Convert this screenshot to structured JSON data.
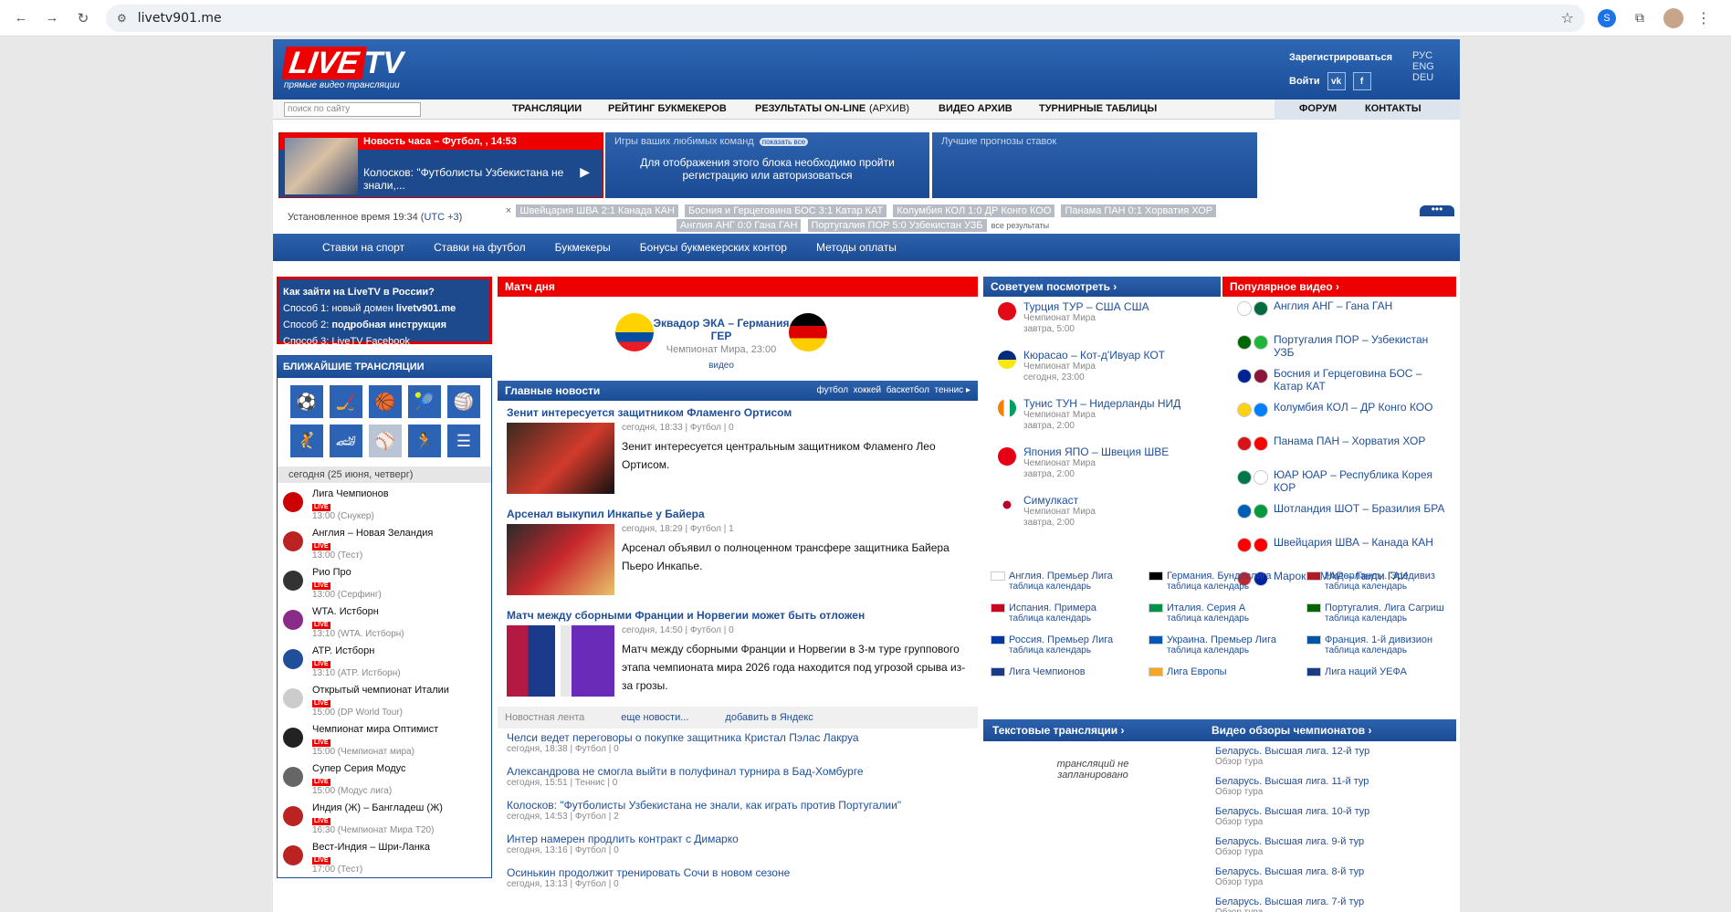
{
  "browser": {
    "url": "livetv901.me"
  },
  "header": {
    "logo_live": "LIVE",
    "logo_tv": "TV",
    "logo_sub": "прямые видео трансляции",
    "register": "Зарегистрироваться",
    "login": "Войти",
    "vk": "vk",
    "fb": "f",
    "langs": [
      "РУС",
      "ENG",
      "DEU"
    ]
  },
  "menu": {
    "search_placeholder": "поиск по сайту",
    "items": [
      "ТРАНСЛЯЦИИ",
      "РЕЙТИНГ БУКМЕКЕРОВ",
      "РЕЗУЛЬТАТЫ ON-LINE",
      "(АРХИВ)",
      "ВИДЕО АРХИВ",
      "ТУРНИРНЫЕ ТАБЛИЦЫ",
      "ФОРУМ",
      "КОНТАКТЫ"
    ]
  },
  "news_hour": {
    "title": "Новость часа – Футбол, , 14:53",
    "text": "Колосков: \"Футболисты Узбекистана не знали,..."
  },
  "fav": {
    "title": "Игры ваших любимых команд",
    "tag": "показать все",
    "body": "Для отображения этого блока необходимо пройти регистрацию или авторизоваться"
  },
  "forecast": {
    "title": "Лучшие прогнозы ставок"
  },
  "time": {
    "label": "Установленное время 19:34 (",
    "tz": "UTC +3",
    ")": ")"
  },
  "ticker": {
    "x": "×",
    "matches": [
      "Швейцария ШВА 2:1 Канада КАН",
      "Босния и Герцеговина БОС 3:1 Катар КАТ",
      "Колумбия КОЛ 1:0 ДР Конго КОО",
      "Панама ПАН 0:1 Хорватия ХОР",
      "Англия АНГ 0:0 Гана ГАН",
      "Португалия ПОР 5:0 Узбекистан УЗБ"
    ],
    "all": "все результаты",
    "more": "•••"
  },
  "bar": [
    "Ставки на спорт",
    "Ставки на футбол",
    "Букмекеры",
    "Бонусы букмекерских контор",
    "Методы оплаты"
  ],
  "howto": {
    "title": "Как зайти на LiveTV в России?",
    "l1": "Способ 1: новый домен ",
    "l1b": "livetv901.me",
    "l2": "Способ 2: ",
    "l2b": "подробная инструкция",
    "l3": "Способ 3: LiveTV Facebook"
  },
  "near": {
    "title": "БЛИЖАЙШИЕ ТРАНСЛЯЦИИ",
    "day": "сегодня (25 июня, четверг)",
    "icons": [
      "soccer-icon",
      "hockey-icon",
      "basketball-icon",
      "tennis-icon",
      "volleyball-icon",
      "handball-icon",
      "racing-icon",
      "baseball-icon",
      "athletics-icon",
      "menu-icon"
    ],
    "items": [
      {
        "n": "Лига Чемпионов",
        "s": "13:00 (Снукер)",
        "c": "#c00"
      },
      {
        "n": "Англия – Новая Зеландия",
        "s": "13:00 (Тест)",
        "c": "#b22"
      },
      {
        "n": "Рио Про",
        "s": "13:00 (Серфинг)",
        "c": "#333"
      },
      {
        "n": "WTA. Истборн",
        "s": "13:10 (WTA. Истборн)",
        "c": "#8a2b8a"
      },
      {
        "n": "ATP. Истборн",
        "s": "13:10 (ATP. Истборн)",
        "c": "#1f4f9a"
      },
      {
        "n": "Открытый чемпионат Италии",
        "s": "15:00 (DP World Tour)",
        "c": "#ccc"
      },
      {
        "n": "Чемпионат мира Оптимист",
        "s": "15:00 (Чемпионат мира)",
        "c": "#222"
      },
      {
        "n": "Супер Серия Модус",
        "s": "15:00 (Модус лига)",
        "c": "#666"
      },
      {
        "n": "Индия (Ж) – Бангладеш (Ж)",
        "s": "16:30 (Чемпионат Мира Т20)",
        "c": "#b22"
      },
      {
        "n": "Вест-Индия – Шри-Ланка",
        "s": "17:00 (Тест)",
        "c": "#b22"
      }
    ],
    "live": "LIVE"
  },
  "motd": {
    "title": "Матч дня",
    "teams": "Эквадор ЭКА – Германия ГЕР",
    "tour": "Чемпионат Мира, 23:00",
    "video": "видео"
  },
  "news": {
    "title": "Главные новости",
    "cats": [
      "футбол",
      "хоккей",
      "баскетбол",
      "теннис"
    ],
    "items": [
      {
        "t": "Зенит интересуется защитником Фламенго Ортисом",
        "m": "сегодня, 18:33 | Футбол | 0",
        "d": "Зенит интересуется центральным защитником Фламенго Лео Ортисом."
      },
      {
        "t": "Арсенал выкупил Инкапье у Байера",
        "m": "сегодня, 18:29 | Футбол | 1",
        "d": "Арсенал объявил о полноценном трансфере защитника Байера Пьеро Инкапье."
      },
      {
        "t": "Матч между сборными Франции и Норвегии может быть отложен",
        "m": "сегодня, 14:50 | Футбол | 0",
        "d": "Матч между сборными Франции и Норвегии в 3-м туре группового этапа чемпионата мира 2026 года находится под угрозой срыва из-за грозы."
      }
    ]
  },
  "feed": {
    "title": "Новостная лента",
    "more": "еще новости...",
    "add": "добавить в Яндекс",
    "items": [
      {
        "l": "Челси ведет переговоры о покупке защитника Кристал Пэлас Лакруа",
        "m": "сегодня, 18:38 | Футбол | 0"
      },
      {
        "l": "Александрова не смогла выйти в полуфинал турнира в Бад-Хомбурге",
        "m": "сегодня, 15:51 | Теннис | 0"
      },
      {
        "l": "Колосков: \"Футболисты Узбекистана не знали, как играть против Португалии\"",
        "m": "сегодня, 14:53 | Футбол | 2"
      },
      {
        "l": "Интер намерен продлить контракт с Димарко",
        "m": "сегодня, 13:16 | Футбол | 0"
      },
      {
        "l": "Осинькин продолжит тренировать Сочи в новом сезоне",
        "m": "сегодня, 13:13 | Футбол | 0"
      }
    ]
  },
  "recommend": {
    "title": "Советуем посмотреть",
    "items": [
      {
        "t": "Турция ТУР – США США",
        "s1": "Чемпионат Мира",
        "s2": "завтра, 5:00"
      },
      {
        "t": "Кюрасао – Кот-д'Ивуар КОТ",
        "s1": "Чемпионат Мира",
        "s2": "сегодня, 23:00"
      },
      {
        "t": "Тунис ТУН – Нидерланды НИД",
        "s1": "Чемпионат Мира",
        "s2": "завтра, 2:00"
      },
      {
        "t": "Япония ЯПО – Швеция ШВЕ",
        "s1": "Чемпионат Мира",
        "s2": "завтра, 2:00"
      },
      {
        "t": "Симулкаст",
        "s1": "Чемпионат Мира",
        "s2": "завтра, 2:00"
      }
    ]
  },
  "popular": {
    "title": "Популярное видео",
    "items": [
      "Англия АНГ – Гана ГАН",
      "Португалия ПОР – Узбекистан УЗБ",
      "Босния и Герцеговина БОС – Катар КАТ",
      "Колумбия КОЛ – ДР Конго КОО",
      "Панама ПАН – Хорватия ХОР",
      "ЮАР ЮАР – Республика Корея КОР",
      "Шотландия ШОТ – Бразилия БРА",
      "Швейцария ШВА – Канада КАН",
      "Марокко МАР – Гаити ГАИ"
    ]
  },
  "leagues": {
    "sub": "таблица календарь",
    "items": [
      "Англия. Премьер Лига",
      "Германия. Бундеслига",
      "Нидерланды. Эредивиз",
      "Испания. Примера",
      "Италия. Серия А",
      "Португалия. Лига Сагриш",
      "Россия. Премьер Лига",
      "Украина. Премьер Лига",
      "Франция. 1-й дивизион",
      "Лига Чемпионов",
      "Лига Европы",
      "Лига наций УЕФА"
    ]
  },
  "text_tr": {
    "title": "Текстовые трансляции",
    "none": "трансляций не запланировано"
  },
  "video_rev": {
    "title": "Видео обзоры чемпионатов",
    "sub": "Обзор тура",
    "items": [
      "Беларусь. Высшая лига. 12-й тур",
      "Беларусь. Высшая лига. 11-й тур",
      "Беларусь. Высшая лига. 10-й тур",
      "Беларусь. Высшая лига. 9-й тур",
      "Беларусь. Высшая лига. 8-й тур",
      "Беларусь. Высшая лига. 7-й тур"
    ]
  }
}
